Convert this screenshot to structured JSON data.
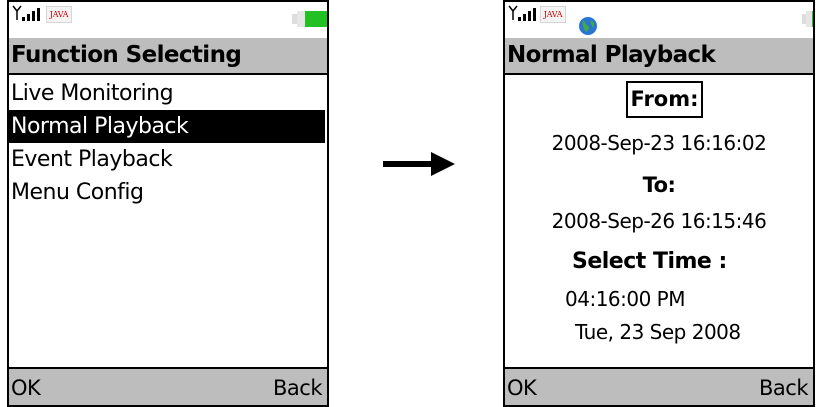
{
  "left_screen": {
    "status": {
      "java_badge": "JAVA"
    },
    "title": "Function Selecting",
    "menu_items": [
      "Live Monitoring",
      "Normal Playback",
      "Event Playback",
      "Menu Config"
    ],
    "selected_index": 1,
    "softkeys": {
      "left": "OK",
      "right": "Back"
    }
  },
  "right_screen": {
    "status": {
      "java_badge": "JAVA"
    },
    "title": "Normal Playback",
    "from_label": "From:",
    "from_value": "2008-Sep-23  16:16:02",
    "to_label": "To:",
    "to_value": "2008-Sep-26  16:15:46",
    "select_time_label": "Select Time :",
    "time_value": "04:16:00 PM",
    "date_value": "Tue, 23 Sep 2008",
    "softkeys": {
      "left": "OK",
      "right": "Back"
    }
  },
  "icons": {
    "signal": "signal-strength-icon",
    "java": "java-icon",
    "battery": "battery-icon",
    "globe": "globe-icon",
    "arrow": "right-arrow-icon"
  },
  "colors": {
    "bar_gray": "#bdbdbd",
    "selection": "#000000",
    "battery_green": "#22c022",
    "java_red": "#cc0000"
  }
}
